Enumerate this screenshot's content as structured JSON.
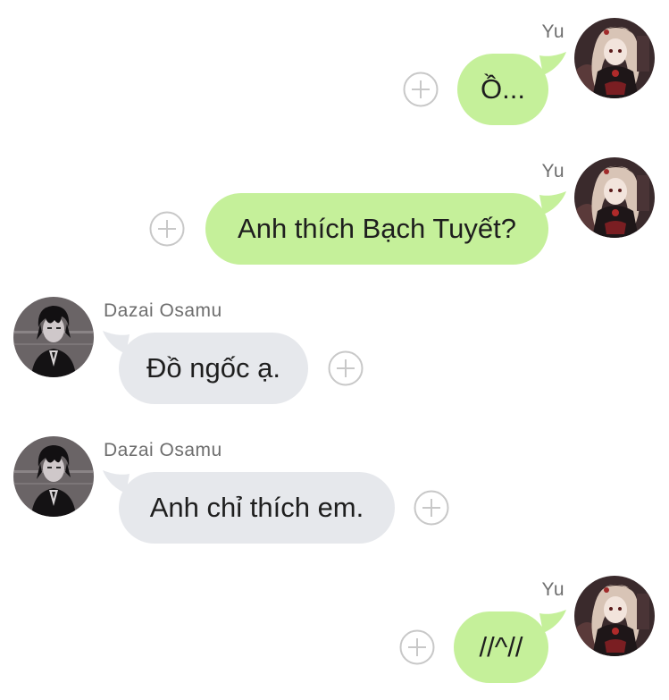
{
  "colors": {
    "outgoing_bubble": "#c5f09a",
    "incoming_bubble": "#e6e8ec",
    "sender_name": "#6e6e6e",
    "add_icon": "#c8c8c8"
  },
  "messages": [
    {
      "sender": "Yu",
      "text": "Ồ...",
      "direction": "outgoing",
      "add_icon": "plus-circle-icon"
    },
    {
      "sender": "Yu",
      "text": "Anh thích Bạch Tuyết?",
      "direction": "outgoing",
      "add_icon": "plus-circle-icon"
    },
    {
      "sender": "Dazai Osamu",
      "text": "Đồ ngốc ạ.",
      "direction": "incoming",
      "add_icon": "plus-circle-icon"
    },
    {
      "sender": "Dazai Osamu",
      "text": "Anh chỉ thích em.",
      "direction": "incoming",
      "add_icon": "plus-circle-icon"
    },
    {
      "sender": "Yu",
      "text": "//^//",
      "direction": "outgoing",
      "add_icon": "plus-circle-icon"
    }
  ]
}
